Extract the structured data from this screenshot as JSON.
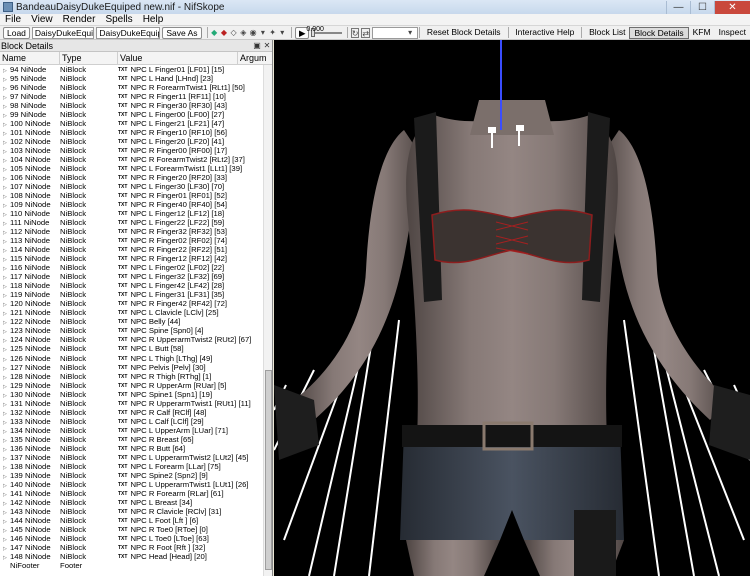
{
  "window": {
    "title": "BandeauDaisyDukeEquiped new.nif - NifSkope",
    "controls": {
      "minimize": "—",
      "maximize": "☐",
      "close": "✕"
    }
  },
  "menu": [
    "File",
    "View",
    "Render",
    "Spells",
    "Help"
  ],
  "toolbar": {
    "load": "Load",
    "load_file": "DaisyDukeEquiped new.nif",
    "save_file": "DaisyDukeEquiped new.nif",
    "save_as": "Save As",
    "anim_time": "0.000",
    "reset_block_details": "Reset Block Details",
    "interactive_help": "Interactive Help",
    "block_list": "Block List",
    "block_details": "Block Details",
    "kfm": "KFM",
    "inspect": "Inspect"
  },
  "panel": {
    "title": "Block Details",
    "columns": [
      "Name",
      "Type",
      "Value",
      "Argum"
    ],
    "rows": [
      [
        "94 NiNode",
        "NiBlock",
        "NPC L Finger01 [LF01] [15]"
      ],
      [
        "95 NiNode",
        "NiBlock",
        "NPC L Hand [LHnd] [23]"
      ],
      [
        "96 NiNode",
        "NiBlock",
        "NPC R ForearmTwist1 [RLt1] [50]"
      ],
      [
        "97 NiNode",
        "NiBlock",
        "NPC R Finger11 [RF11] [10]"
      ],
      [
        "98 NiNode",
        "NiBlock",
        "NPC R Finger30 [RF30] [43]"
      ],
      [
        "99 NiNode",
        "NiBlock",
        "NPC L Finger00 [LF00] [27]"
      ],
      [
        "100 NiNode",
        "NiBlock",
        "NPC L Finger21 [LF21] [47]"
      ],
      [
        "101 NiNode",
        "NiBlock",
        "NPC R Finger10 [RF10] [56]"
      ],
      [
        "102 NiNode",
        "NiBlock",
        "NPC L Finger20 [LF20] [41]"
      ],
      [
        "103 NiNode",
        "NiBlock",
        "NPC R Finger00 [RF00] [17]"
      ],
      [
        "104 NiNode",
        "NiBlock",
        "NPC R ForearmTwist2 [RLt2] [37]"
      ],
      [
        "105 NiNode",
        "NiBlock",
        "NPC L ForearmTwist1 [LLt1] [39]"
      ],
      [
        "106 NiNode",
        "NiBlock",
        "NPC R Finger20 [RF20] [33]"
      ],
      [
        "107 NiNode",
        "NiBlock",
        "NPC L Finger30 [LF30] [70]"
      ],
      [
        "108 NiNode",
        "NiBlock",
        "NPC R Finger01 [RF01] [52]"
      ],
      [
        "109 NiNode",
        "NiBlock",
        "NPC R Finger40 [RF40] [54]"
      ],
      [
        "110 NiNode",
        "NiBlock",
        "NPC L Finger12 [LF12] [18]"
      ],
      [
        "111 NiNode",
        "NiBlock",
        "NPC L Finger22 [LF22] [59]"
      ],
      [
        "112 NiNode",
        "NiBlock",
        "NPC R Finger32 [RF32] [53]"
      ],
      [
        "113 NiNode",
        "NiBlock",
        "NPC R Finger02 [RF02] [74]"
      ],
      [
        "114 NiNode",
        "NiBlock",
        "NPC R Finger22 [RF22] [51]"
      ],
      [
        "115 NiNode",
        "NiBlock",
        "NPC R Finger12 [RF12] [42]"
      ],
      [
        "116 NiNode",
        "NiBlock",
        "NPC L Finger02 [LF02] [22]"
      ],
      [
        "117 NiNode",
        "NiBlock",
        "NPC L Finger32 [LF32] [69]"
      ],
      [
        "118 NiNode",
        "NiBlock",
        "NPC L Finger42 [LF42] [28]"
      ],
      [
        "119 NiNode",
        "NiBlock",
        "NPC L Finger31 [LF31] [35]"
      ],
      [
        "120 NiNode",
        "NiBlock",
        "NPC R Finger42 [RF42] [72]"
      ],
      [
        "121 NiNode",
        "NiBlock",
        "NPC L Clavicle [LClv] [25]"
      ],
      [
        "122 NiNode",
        "NiBlock",
        "NPC Belly [44]"
      ],
      [
        "123 NiNode",
        "NiBlock",
        "NPC Spine [Spn0] [4]"
      ],
      [
        "124 NiNode",
        "NiBlock",
        "NPC R UpperarmTwist2 [RUt2] [67]"
      ],
      [
        "125 NiNode",
        "NiBlock",
        "NPC L Butt [58]"
      ],
      [
        "126 NiNode",
        "NiBlock",
        "NPC L Thigh [LThg] [49]"
      ],
      [
        "127 NiNode",
        "NiBlock",
        "NPC Pelvis [Pelv] [30]"
      ],
      [
        "128 NiNode",
        "NiBlock",
        "NPC R Thigh [RThg] [1]"
      ],
      [
        "129 NiNode",
        "NiBlock",
        "NPC R UpperArm [RUar] [5]"
      ],
      [
        "130 NiNode",
        "NiBlock",
        "NPC Spine1 [Spn1] [19]"
      ],
      [
        "131 NiNode",
        "NiBlock",
        "NPC R UpperarmTwist1 [RUt1] [11]"
      ],
      [
        "132 NiNode",
        "NiBlock",
        "NPC R Calf [RClf] [48]"
      ],
      [
        "133 NiNode",
        "NiBlock",
        "NPC L Calf [LClf] [29]"
      ],
      [
        "134 NiNode",
        "NiBlock",
        "NPC L UpperArm [LUar] [71]"
      ],
      [
        "135 NiNode",
        "NiBlock",
        "NPC R Breast [65]"
      ],
      [
        "136 NiNode",
        "NiBlock",
        "NPC R Butt [64]"
      ],
      [
        "137 NiNode",
        "NiBlock",
        "NPC L UpperarmTwist2 [LUt2] [45]"
      ],
      [
        "138 NiNode",
        "NiBlock",
        "NPC L Forearm [LLar] [75]"
      ],
      [
        "139 NiNode",
        "NiBlock",
        "NPC Spine2 [Spn2] [9]"
      ],
      [
        "140 NiNode",
        "NiBlock",
        "NPC L UpperarmTwist1 [LUt1] [26]"
      ],
      [
        "141 NiNode",
        "NiBlock",
        "NPC R Forearm [RLar] [61]"
      ],
      [
        "142 NiNode",
        "NiBlock",
        "NPC L Breast [34]"
      ],
      [
        "143 NiNode",
        "NiBlock",
        "NPC R Clavicle [RClv] [31]"
      ],
      [
        "144 NiNode",
        "NiBlock",
        "NPC L Foot [Lft ] [6]"
      ],
      [
        "145 NiNode",
        "NiBlock",
        "NPC R Toe0 [RToe] [0]"
      ],
      [
        "146 NiNode",
        "NiBlock",
        "NPC L Toe0 [LToe] [63]"
      ],
      [
        "147 NiNode",
        "NiBlock",
        "NPC R Foot [Rft ] [32]"
      ],
      [
        "148 NiNode",
        "NiBlock",
        "NPC Head [Head] [20]"
      ],
      [
        "NiFooter",
        "Footer",
        ""
      ]
    ]
  },
  "icons": {
    "app": "app-icon",
    "play": "play-icon",
    "view_a": "eye-icon",
    "view_b": "rotate-icon"
  },
  "colors": {
    "viewport_bg": "#000000",
    "bone_lines": "#ffffff",
    "axis_line": "#3a4dff",
    "skin": "#7b6f6b",
    "denim": "#2f3640"
  }
}
